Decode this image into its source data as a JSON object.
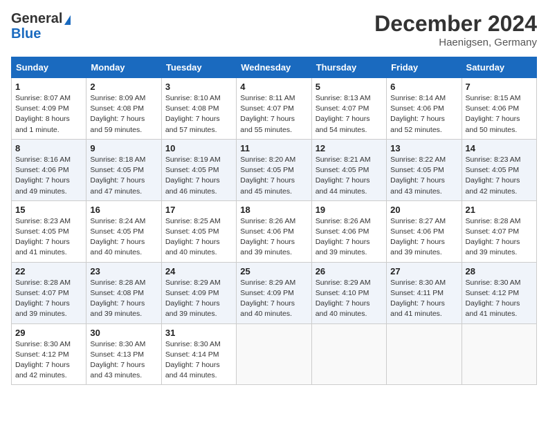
{
  "header": {
    "logo_general": "General",
    "logo_blue": "Blue",
    "month_title": "December 2024",
    "location": "Haenigsen, Germany"
  },
  "days_of_week": [
    "Sunday",
    "Monday",
    "Tuesday",
    "Wednesday",
    "Thursday",
    "Friday",
    "Saturday"
  ],
  "weeks": [
    [
      {
        "day": "1",
        "sunrise": "Sunrise: 8:07 AM",
        "sunset": "Sunset: 4:09 PM",
        "daylight": "Daylight: 8 hours and 1 minute."
      },
      {
        "day": "2",
        "sunrise": "Sunrise: 8:09 AM",
        "sunset": "Sunset: 4:08 PM",
        "daylight": "Daylight: 7 hours and 59 minutes."
      },
      {
        "day": "3",
        "sunrise": "Sunrise: 8:10 AM",
        "sunset": "Sunset: 4:08 PM",
        "daylight": "Daylight: 7 hours and 57 minutes."
      },
      {
        "day": "4",
        "sunrise": "Sunrise: 8:11 AM",
        "sunset": "Sunset: 4:07 PM",
        "daylight": "Daylight: 7 hours and 55 minutes."
      },
      {
        "day": "5",
        "sunrise": "Sunrise: 8:13 AM",
        "sunset": "Sunset: 4:07 PM",
        "daylight": "Daylight: 7 hours and 54 minutes."
      },
      {
        "day": "6",
        "sunrise": "Sunrise: 8:14 AM",
        "sunset": "Sunset: 4:06 PM",
        "daylight": "Daylight: 7 hours and 52 minutes."
      },
      {
        "day": "7",
        "sunrise": "Sunrise: 8:15 AM",
        "sunset": "Sunset: 4:06 PM",
        "daylight": "Daylight: 7 hours and 50 minutes."
      }
    ],
    [
      {
        "day": "8",
        "sunrise": "Sunrise: 8:16 AM",
        "sunset": "Sunset: 4:06 PM",
        "daylight": "Daylight: 7 hours and 49 minutes."
      },
      {
        "day": "9",
        "sunrise": "Sunrise: 8:18 AM",
        "sunset": "Sunset: 4:05 PM",
        "daylight": "Daylight: 7 hours and 47 minutes."
      },
      {
        "day": "10",
        "sunrise": "Sunrise: 8:19 AM",
        "sunset": "Sunset: 4:05 PM",
        "daylight": "Daylight: 7 hours and 46 minutes."
      },
      {
        "day": "11",
        "sunrise": "Sunrise: 8:20 AM",
        "sunset": "Sunset: 4:05 PM",
        "daylight": "Daylight: 7 hours and 45 minutes."
      },
      {
        "day": "12",
        "sunrise": "Sunrise: 8:21 AM",
        "sunset": "Sunset: 4:05 PM",
        "daylight": "Daylight: 7 hours and 44 minutes."
      },
      {
        "day": "13",
        "sunrise": "Sunrise: 8:22 AM",
        "sunset": "Sunset: 4:05 PM",
        "daylight": "Daylight: 7 hours and 43 minutes."
      },
      {
        "day": "14",
        "sunrise": "Sunrise: 8:23 AM",
        "sunset": "Sunset: 4:05 PM",
        "daylight": "Daylight: 7 hours and 42 minutes."
      }
    ],
    [
      {
        "day": "15",
        "sunrise": "Sunrise: 8:23 AM",
        "sunset": "Sunset: 4:05 PM",
        "daylight": "Daylight: 7 hours and 41 minutes."
      },
      {
        "day": "16",
        "sunrise": "Sunrise: 8:24 AM",
        "sunset": "Sunset: 4:05 PM",
        "daylight": "Daylight: 7 hours and 40 minutes."
      },
      {
        "day": "17",
        "sunrise": "Sunrise: 8:25 AM",
        "sunset": "Sunset: 4:05 PM",
        "daylight": "Daylight: 7 hours and 40 minutes."
      },
      {
        "day": "18",
        "sunrise": "Sunrise: 8:26 AM",
        "sunset": "Sunset: 4:06 PM",
        "daylight": "Daylight: 7 hours and 39 minutes."
      },
      {
        "day": "19",
        "sunrise": "Sunrise: 8:26 AM",
        "sunset": "Sunset: 4:06 PM",
        "daylight": "Daylight: 7 hours and 39 minutes."
      },
      {
        "day": "20",
        "sunrise": "Sunrise: 8:27 AM",
        "sunset": "Sunset: 4:06 PM",
        "daylight": "Daylight: 7 hours and 39 minutes."
      },
      {
        "day": "21",
        "sunrise": "Sunrise: 8:28 AM",
        "sunset": "Sunset: 4:07 PM",
        "daylight": "Daylight: 7 hours and 39 minutes."
      }
    ],
    [
      {
        "day": "22",
        "sunrise": "Sunrise: 8:28 AM",
        "sunset": "Sunset: 4:07 PM",
        "daylight": "Daylight: 7 hours and 39 minutes."
      },
      {
        "day": "23",
        "sunrise": "Sunrise: 8:28 AM",
        "sunset": "Sunset: 4:08 PM",
        "daylight": "Daylight: 7 hours and 39 minutes."
      },
      {
        "day": "24",
        "sunrise": "Sunrise: 8:29 AM",
        "sunset": "Sunset: 4:09 PM",
        "daylight": "Daylight: 7 hours and 39 minutes."
      },
      {
        "day": "25",
        "sunrise": "Sunrise: 8:29 AM",
        "sunset": "Sunset: 4:09 PM",
        "daylight": "Daylight: 7 hours and 40 minutes."
      },
      {
        "day": "26",
        "sunrise": "Sunrise: 8:29 AM",
        "sunset": "Sunset: 4:10 PM",
        "daylight": "Daylight: 7 hours and 40 minutes."
      },
      {
        "day": "27",
        "sunrise": "Sunrise: 8:30 AM",
        "sunset": "Sunset: 4:11 PM",
        "daylight": "Daylight: 7 hours and 41 minutes."
      },
      {
        "day": "28",
        "sunrise": "Sunrise: 8:30 AM",
        "sunset": "Sunset: 4:12 PM",
        "daylight": "Daylight: 7 hours and 41 minutes."
      }
    ],
    [
      {
        "day": "29",
        "sunrise": "Sunrise: 8:30 AM",
        "sunset": "Sunset: 4:12 PM",
        "daylight": "Daylight: 7 hours and 42 minutes."
      },
      {
        "day": "30",
        "sunrise": "Sunrise: 8:30 AM",
        "sunset": "Sunset: 4:13 PM",
        "daylight": "Daylight: 7 hours and 43 minutes."
      },
      {
        "day": "31",
        "sunrise": "Sunrise: 8:30 AM",
        "sunset": "Sunset: 4:14 PM",
        "daylight": "Daylight: 7 hours and 44 minutes."
      },
      null,
      null,
      null,
      null
    ]
  ]
}
